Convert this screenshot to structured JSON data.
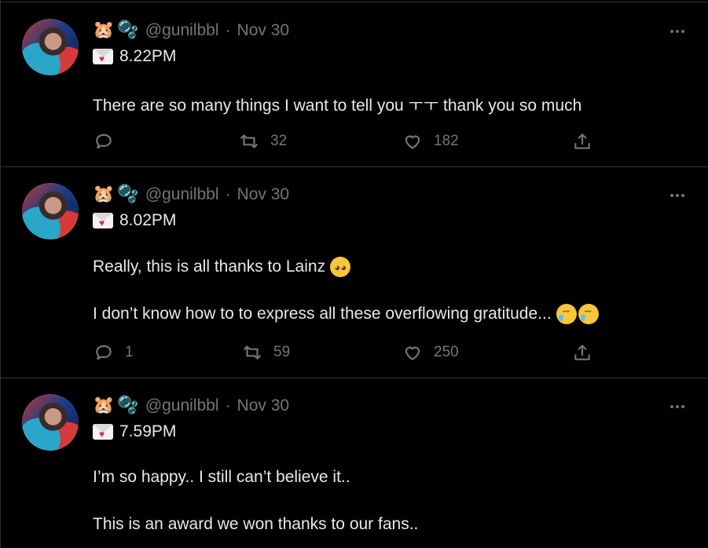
{
  "tweets": [
    {
      "name_emojis": [
        "🐹",
        "🫧"
      ],
      "handle": "@gunilbbl",
      "separator": "·",
      "date": "Nov 30",
      "time": "8.22PM",
      "lines": [
        "There are so many things I want to tell you ㅜㅜ thank you so much"
      ],
      "replies": "",
      "retweets": "32",
      "likes": "182"
    },
    {
      "name_emojis": [
        "🐹",
        "🫧"
      ],
      "handle": "@gunilbbl",
      "separator": "·",
      "date": "Nov 30",
      "time": "8.02PM",
      "lines": [
        "Really, this is all thanks to Lainz",
        "I don’t know how to to express all these overflowing gratitude..."
      ],
      "replies": "1",
      "retweets": "59",
      "likes": "250"
    },
    {
      "name_emojis": [
        "🐹",
        "🫧"
      ],
      "handle": "@gunilbbl",
      "separator": "·",
      "date": "Nov 30",
      "time": "7.59PM",
      "lines": [
        "I’m so happy.. I still can’t believe it..",
        "This is an award we won thanks to our fans.."
      ],
      "replies": "",
      "retweets": "",
      "likes": ""
    }
  ],
  "icons": {
    "reply": "reply-icon",
    "retweet": "retweet-icon",
    "like": "heart-icon",
    "share": "share-icon",
    "more": "more-icon",
    "envelope": "love-letter-icon"
  },
  "colors": {
    "background": "#000000",
    "text": "#e7e9ea",
    "secondary": "#71767b",
    "divider": "#2f3336"
  }
}
